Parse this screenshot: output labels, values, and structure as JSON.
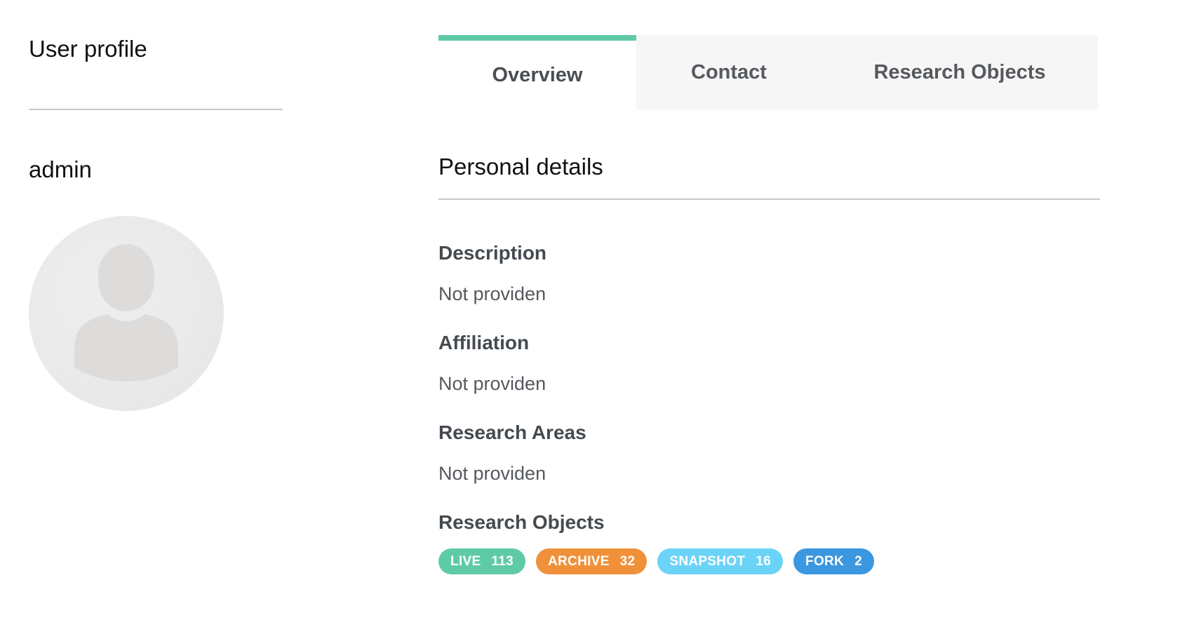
{
  "sidebar": {
    "title": "User profile",
    "username": "admin",
    "avatar_icon": "user-silhouette-icon"
  },
  "tabs": [
    {
      "label": "Overview",
      "active": true
    },
    {
      "label": "Contact",
      "active": false
    },
    {
      "label": "Research Objects",
      "active": false
    }
  ],
  "personal_details": {
    "title": "Personal details",
    "fields": [
      {
        "label": "Description",
        "value": "Not providen"
      },
      {
        "label": "Affiliation",
        "value": "Not providen"
      },
      {
        "label": "Research Areas",
        "value": "Not providen"
      },
      {
        "label": "Research Objects"
      }
    ]
  },
  "research_object_badges": [
    {
      "label": "LIVE",
      "count": "113",
      "color": "#5fcba6"
    },
    {
      "label": "ARCHIVE",
      "count": "32",
      "color": "#f0913a"
    },
    {
      "label": "SNAPSHOT",
      "count": "16",
      "color": "#6bd3f7"
    },
    {
      "label": "FORK",
      "count": "2",
      "color": "#3b97e0"
    }
  ],
  "colors": {
    "accent": "#5fcba6",
    "tab_inactive_bg": "#f6f6f6"
  }
}
